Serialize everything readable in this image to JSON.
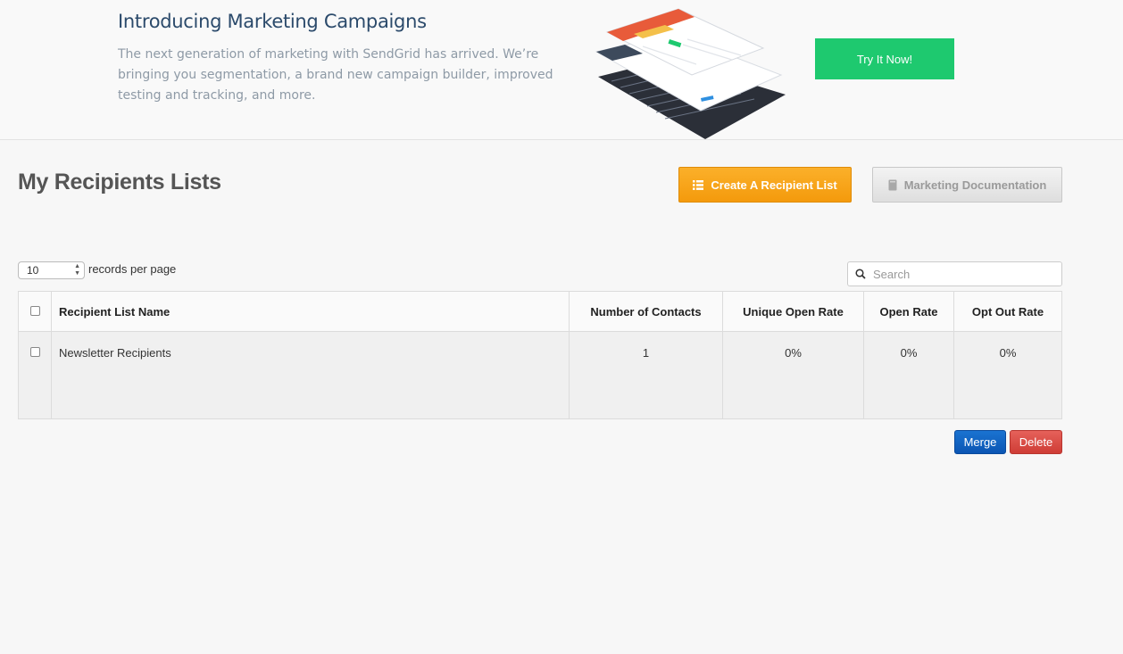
{
  "banner": {
    "title": "Introducing Marketing Campaigns",
    "description": "The next generation of marketing with SendGrid has arrived. We’re bringing you segmentation, a brand new campaign builder, improved testing and tracking, and more.",
    "cta_label": "Try It Now!",
    "cta_color": "#1ec96f"
  },
  "page": {
    "title": "My Recipients Lists"
  },
  "actions": {
    "create_label": "Create A Recipient List",
    "create_icon": "list-icon",
    "docs_label": "Marketing Documentation",
    "docs_icon": "book-icon",
    "create_color": "#f5a014"
  },
  "pagination": {
    "per_page_value": "10",
    "per_page_label": "records per page"
  },
  "search": {
    "placeholder": "Search",
    "icon": "search-icon"
  },
  "table": {
    "headers": {
      "name": "Recipient List Name",
      "contacts": "Number of Contacts",
      "unique_open_rate": "Unique Open Rate",
      "open_rate": "Open Rate",
      "opt_out_rate": "Opt Out Rate"
    },
    "rows": [
      {
        "name": "Newsletter Recipients",
        "contacts": "1",
        "unique_open_rate": "0%",
        "open_rate": "0%",
        "opt_out_rate": "0%"
      }
    ]
  },
  "footer_actions": {
    "merge_label": "Merge",
    "delete_label": "Delete",
    "merge_color": "#0f5fc0",
    "delete_color": "#d9443d"
  }
}
